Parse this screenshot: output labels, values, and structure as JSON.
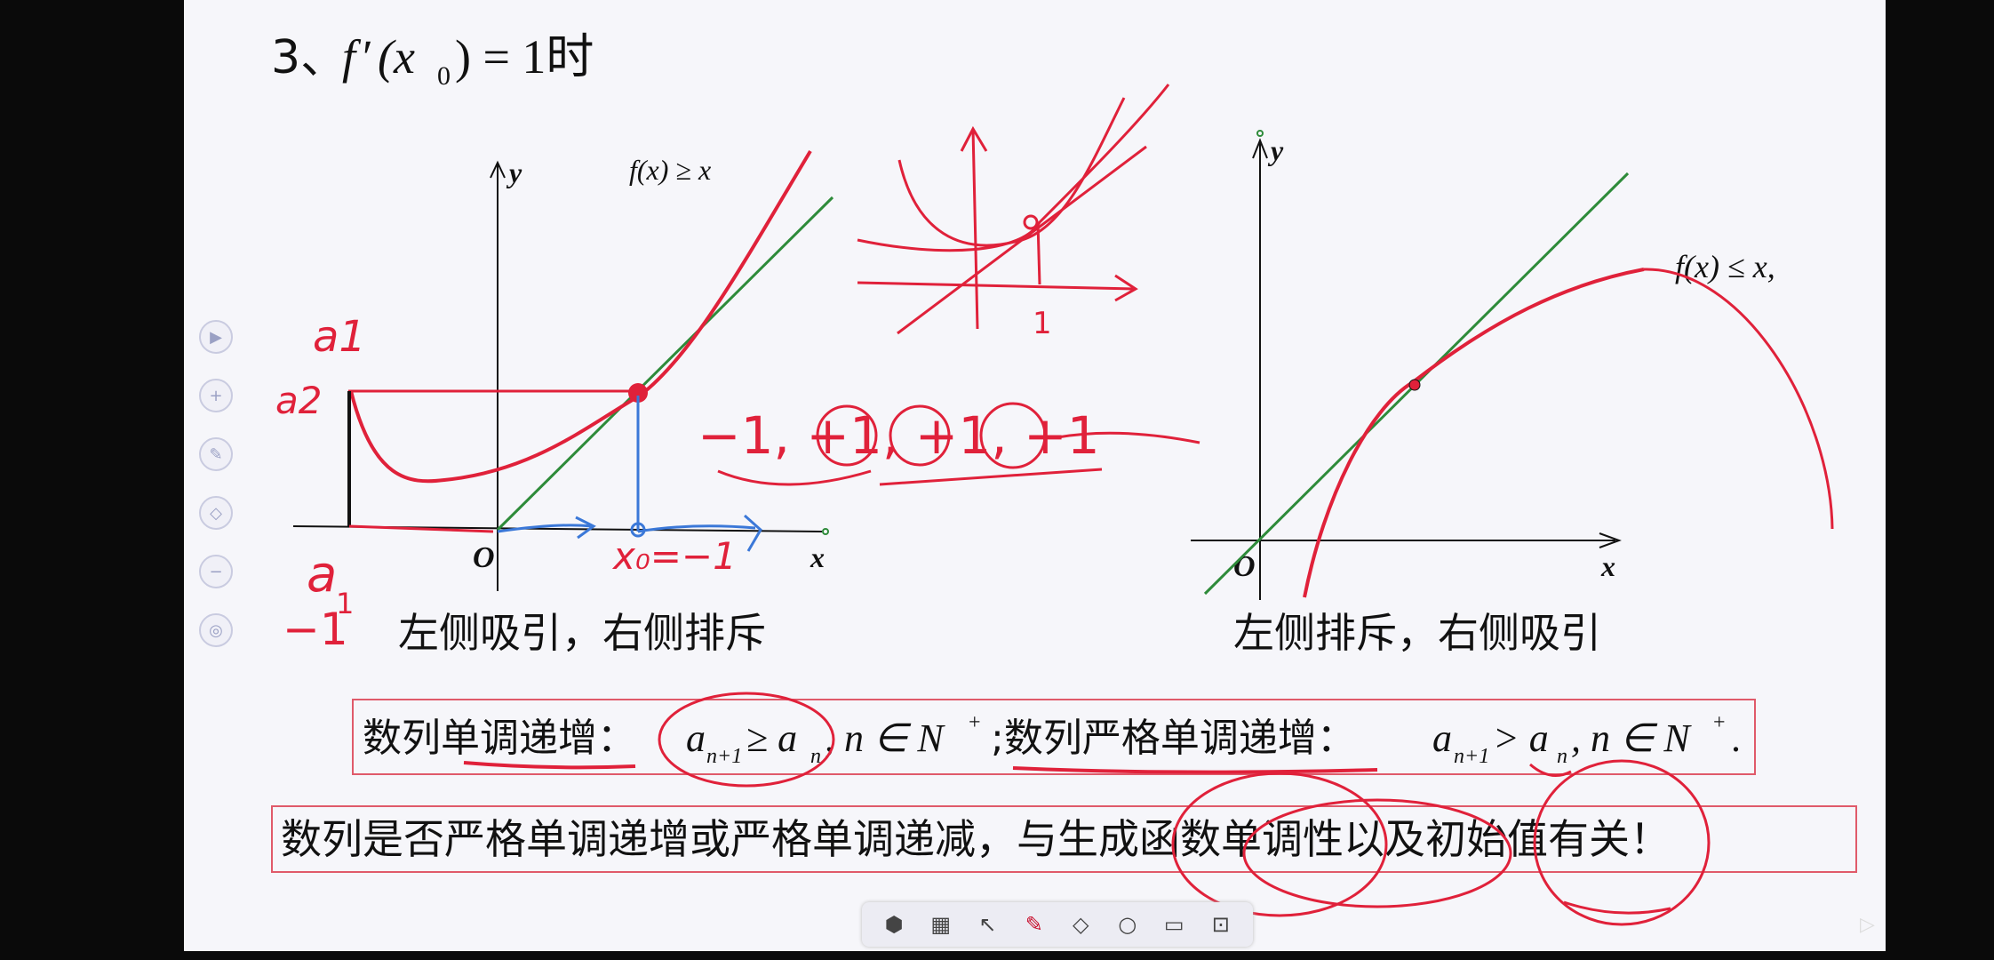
{
  "slide": {
    "heading_num": "3、",
    "heading_fn": "f",
    "heading_prime": "′",
    "heading_arg": "(x",
    "heading_sub": "0",
    "heading_rest": ") = 1时"
  },
  "left_graph": {
    "axis_y": "y",
    "axis_x": "x",
    "origin": "O",
    "condition": "f(x) ≥ x",
    "caption": "左侧吸引，右侧排斥"
  },
  "right_graph": {
    "axis_y": "y",
    "axis_x": "x",
    "origin": "O",
    "condition": "f(x) ≤ x,",
    "caption": "左侧排斥，右侧吸引"
  },
  "box1": {
    "text_a": "数列单调递增：",
    "formula_a": "a",
    "formula_a_sub1": "n+1",
    "formula_a_mid": " ≥ a",
    "formula_a_sub2": "n",
    "formula_a_tail": ", n ∈ N",
    "formula_a_sup": "+",
    "text_b": ";数列严格单调递增：",
    "formula_b": "a",
    "formula_b_sub1": "n+1",
    "formula_b_mid": " > a",
    "formula_b_sub2": "n",
    "formula_b_tail": ", n ∈ N",
    "formula_b_sup": "+",
    "formula_b_end": "."
  },
  "box2": {
    "text": "数列是否严格单调递增或严格单调递减，与生成函数单调性以及初始值有关！"
  },
  "handwriting": {
    "a1_upper": "a1",
    "a2": "a2",
    "a1_lower": "a",
    "a1_lower_sub": "1",
    "minus_one": "−1",
    "x0_label": "x₀=−1",
    "sequence": "−1, +1, +1, +1",
    "tick_one": "1"
  },
  "colors": {
    "board": "#f6f6fa",
    "ink_red": "#e0213a",
    "tangent_green": "#2e8b3a",
    "axis_blue": "#3b78d8",
    "box_border": "#e05a6a"
  },
  "toolbar": {
    "items": [
      "board-icon",
      "grid-icon",
      "pointer-icon",
      "pen-icon",
      "eraser-icon",
      "zoom-icon",
      "screen-icon",
      "present-icon"
    ]
  },
  "side_tools": [
    "play-icon",
    "add-icon",
    "pen-icon",
    "shape-icon",
    "minus-icon",
    "color-icon"
  ]
}
